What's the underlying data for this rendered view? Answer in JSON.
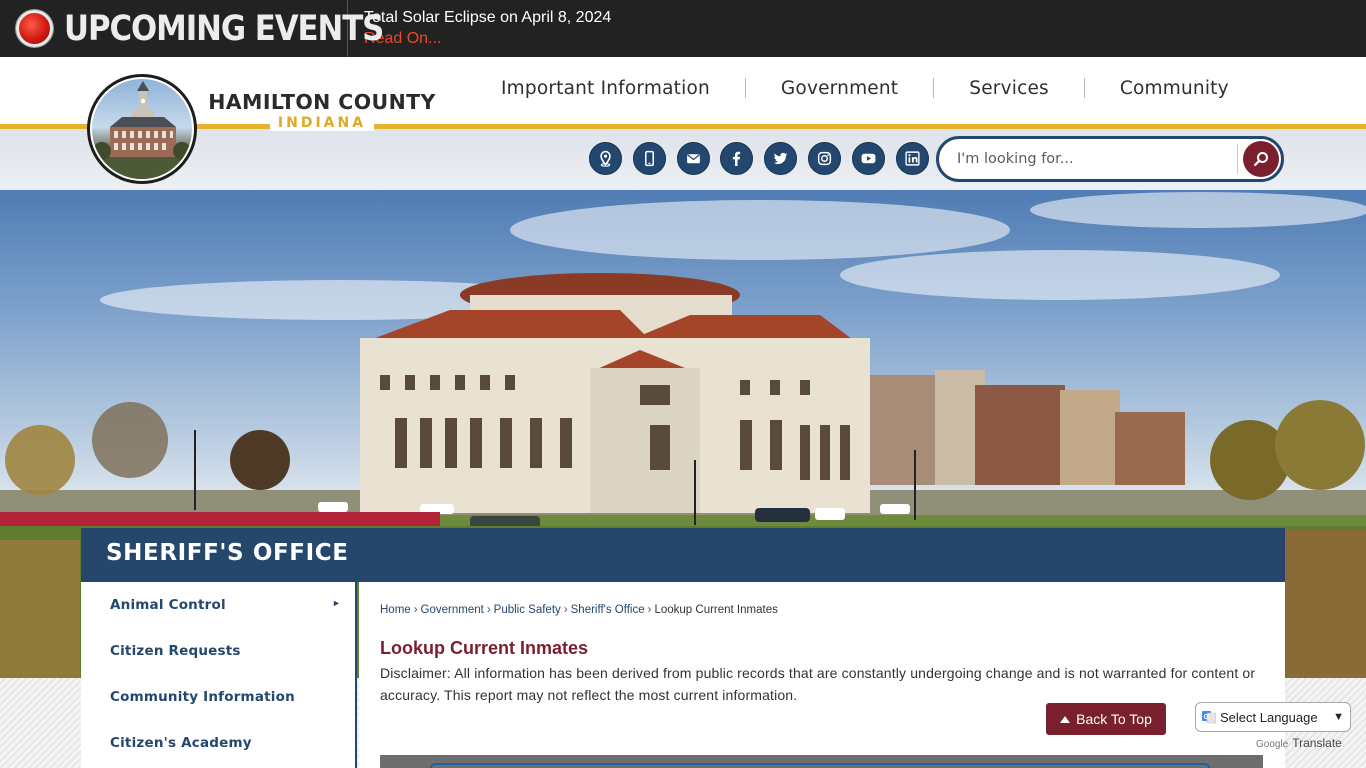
{
  "alert": {
    "label": "UPCOMING EVENTS",
    "message": "Total Solar Eclipse on April 8, 2024",
    "read_on": "Read On..."
  },
  "logo": {
    "name": "HAMILTON COUNTY",
    "state": "INDIANA"
  },
  "nav": {
    "items": [
      "Important Information",
      "Government",
      "Services",
      "Community"
    ]
  },
  "social": {
    "icons": [
      "map-pin-icon",
      "mobile-phone-icon",
      "email-icon",
      "facebook-icon",
      "twitter-icon",
      "instagram-icon",
      "youtube-icon",
      "linkedin-icon"
    ]
  },
  "search": {
    "placeholder": "I'm looking for..."
  },
  "department": {
    "title": "SHERIFF'S OFFICE"
  },
  "sidebar": {
    "items": [
      "Animal Control",
      "Citizen Requests",
      "Community Information",
      "Citizen's Academy"
    ]
  },
  "breadcrumb": {
    "items": [
      "Home",
      "Government",
      "Public Safety",
      "Sheriff's Office"
    ],
    "current": "Lookup Current Inmates",
    "separator": "›"
  },
  "page": {
    "title": "Lookup Current Inmates",
    "disclaimer": "Disclaimer: All information has been derived from public records that are constantly undergoing change and is not warranted for content or accuracy. This report may not reflect the most current information."
  },
  "back_to_top": "Back To Top",
  "translate": {
    "select_label": "Select Language",
    "powered_by": "Google",
    "translate_label": "Translate"
  },
  "colors": {
    "navy": "#23476e",
    "maroon": "#7a1f2e",
    "gold": "#e7b32d",
    "alert_red": "#e8492e"
  }
}
